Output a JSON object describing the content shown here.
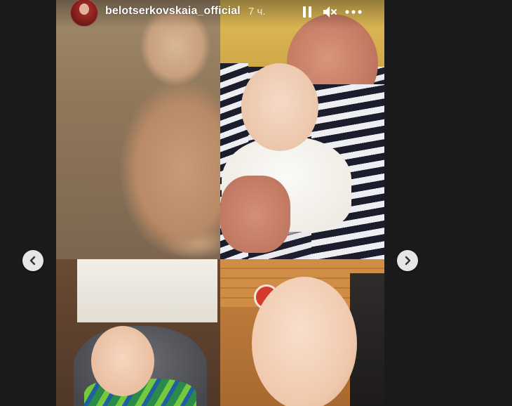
{
  "story": {
    "username": "belotserkovskaia_official",
    "time_ago": "7 ч."
  },
  "controls": {
    "pause_icon": "pause-icon",
    "mute_icon": "muted-speaker-icon",
    "more_icon": "more-horizontal-icon"
  },
  "navigation": {
    "prev_icon": "chevron-left-icon",
    "next_icon": "chevron-right-icon"
  },
  "colors": {
    "background": "#1a1a1a",
    "nav_button": "#e6e6e6",
    "text": "#ffffff"
  }
}
